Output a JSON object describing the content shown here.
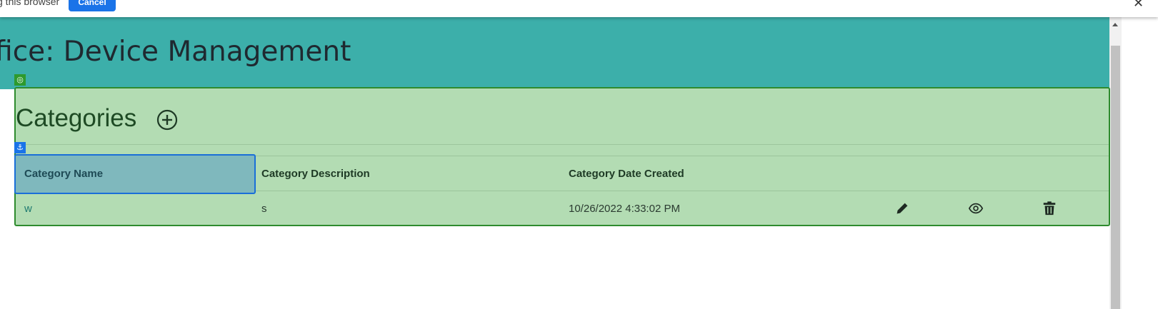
{
  "notification": {
    "text": "g this browser",
    "cancel_label": "Cancel",
    "close_glyph": "✕"
  },
  "header": {
    "title": "ffice: Device Management",
    "color": "#3cafaa"
  },
  "section": {
    "title": "Categories",
    "add_icon": "circle-plus-icon",
    "highlight_color": "#b3dcb3"
  },
  "badges": {
    "target_glyph": "◎",
    "anchor_glyph": "⚓"
  },
  "table": {
    "columns": [
      "Category Name",
      "Category Description",
      "Category Date Created"
    ],
    "rows": [
      {
        "name": "w",
        "description": "s",
        "date_created": "10/26/2022 4:33:02 PM",
        "actions": [
          "pencil-icon",
          "eye-icon",
          "trash-icon"
        ]
      }
    ]
  }
}
